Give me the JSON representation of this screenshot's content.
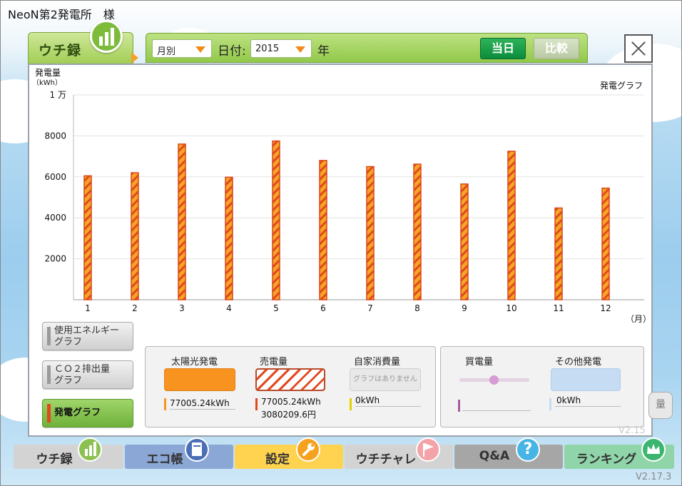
{
  "window_title": "NeoN第2発電所　様",
  "header": {
    "tab_label": "ウチ録",
    "period_select": "月別",
    "date_label": "日付:",
    "year_select": "2015",
    "year_unit": "年",
    "today_button": "当日",
    "compare_button": "比較"
  },
  "chart_header": {
    "ylabel": "発電量",
    "yunit": "（kWh）",
    "graph_label": "発電グラフ",
    "xunit": "（月）"
  },
  "chart_data": {
    "type": "bar",
    "categories": [
      "1",
      "2",
      "3",
      "4",
      "5",
      "6",
      "7",
      "8",
      "9",
      "10",
      "11",
      "12"
    ],
    "values": [
      6050,
      6200,
      7600,
      5980,
      7750,
      6800,
      6500,
      6620,
      5650,
      7250,
      4480,
      5450
    ],
    "ylim": [
      0,
      10000
    ],
    "yticks": [
      {
        "value": 0,
        "label": ""
      },
      {
        "value": 2000,
        "label": "2000"
      },
      {
        "value": 4000,
        "label": "4000"
      },
      {
        "value": 6000,
        "label": "6000"
      },
      {
        "value": 8000,
        "label": "8000"
      },
      {
        "value": 10000,
        "label": "1 万"
      }
    ],
    "grid": true,
    "bar_color": "#f5a623",
    "bar_stripe": "#e2491f"
  },
  "side_buttons": [
    {
      "line1": "使用エネルギー",
      "line2": "グラフ"
    },
    {
      "line1": "ＣＯ２排出量",
      "line2": "グラフ"
    },
    {
      "line1": "発電グラフ",
      "line2": ""
    }
  ],
  "legend": {
    "solar": {
      "title": "太陽光発電",
      "value": "77005.24kWh",
      "color": "#f7931e"
    },
    "sell": {
      "title": "売電量",
      "value": "77005.24kWh",
      "value2": "3080209.6円",
      "color": "#e2491f"
    },
    "self": {
      "title": "自家消費量",
      "no_graph": "グラフはありません",
      "value": "0kWh",
      "color": "#e3d200"
    },
    "buy": {
      "title": "買電量",
      "color": "#a45ea4"
    },
    "other": {
      "title": "その他発電",
      "value": "0kWh",
      "color": "#c5dcf2"
    }
  },
  "version_inner": "V2.15",
  "version_outer": "V2.17.3",
  "side_widget": "量",
  "nav": [
    {
      "label": "ウチ録",
      "bg": "#d3d3d3",
      "icon_bg": "#8cc152"
    },
    {
      "label": "エコ帳",
      "bg": "#8aa7d6",
      "icon_bg": "#4b6fb6"
    },
    {
      "label": "設定",
      "bg": "#ffd34f",
      "icon_bg": "#f6a21f"
    },
    {
      "label": "ウチチャレ",
      "bg": "#d3d3d3",
      "icon_bg": "#f4a3a8"
    },
    {
      "label": "Q&A",
      "bg": "#a6a6a6",
      "icon_bg": "#47b4e6"
    },
    {
      "label": "ランキング",
      "bg": "#8fd5a9",
      "icon_bg": "#3bb56f"
    }
  ]
}
